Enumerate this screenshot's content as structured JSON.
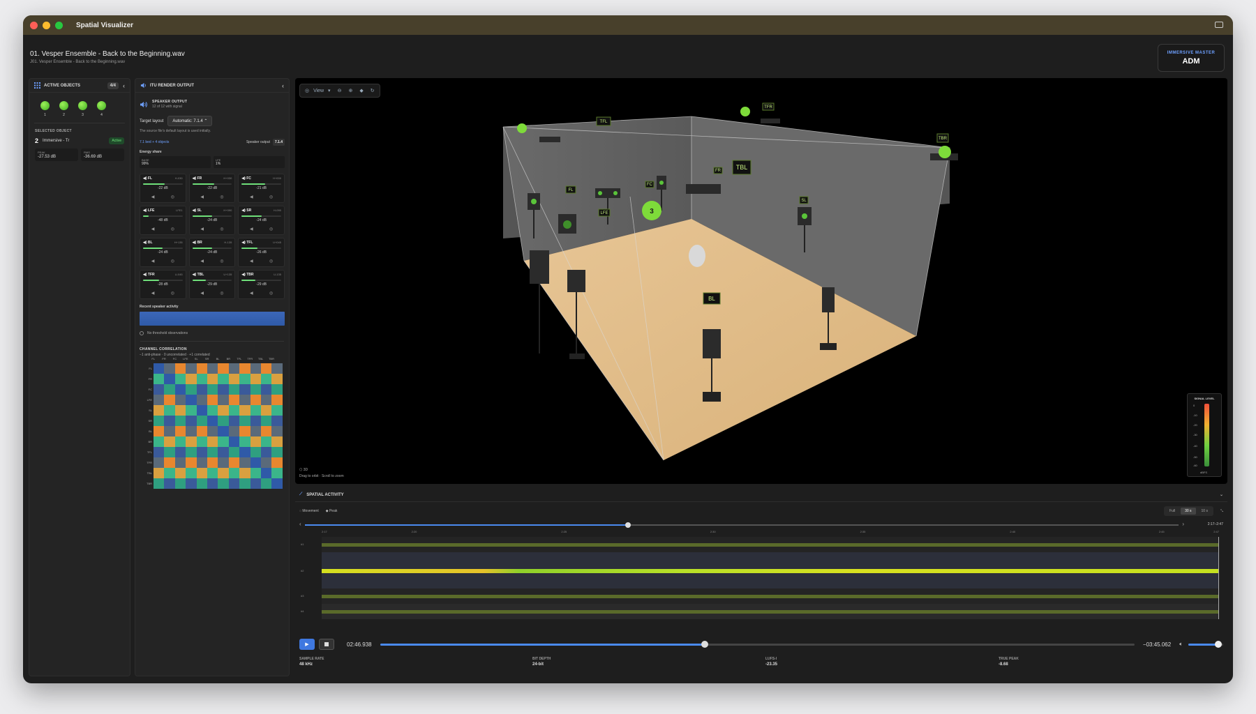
{
  "app": {
    "title": "Spatial Visualizer"
  },
  "file": {
    "title": "01. Vesper Ensemble - Back to the Beginning.wav",
    "subtitle": "J01. Vesper Ensemble - Back to the Beginning.wav"
  },
  "badge": {
    "top": "IMMERSIVE MASTER",
    "main": "ADM"
  },
  "objects_panel": {
    "title": "ACTIVE OBJECTS",
    "count": "4/4",
    "objects": [
      "1",
      "2",
      "3",
      "4"
    ],
    "selected_label": "SELECTED OBJECT",
    "selected_num": "2",
    "selected_name": "Immersive - Tr",
    "active": "Active",
    "peak_label": "PEAK",
    "peak": "-27.53 dB",
    "rms_label": "RMS",
    "rms": "-36.69 dB"
  },
  "render_panel": {
    "title": "ITU RENDER OUTPUT",
    "speaker_output": "SPEAKER OUTPUT",
    "speaker_sub": "12 of 12 with signal",
    "target_label": "Target layout",
    "target_value": "Automatic: 7.1.4",
    "note": "The source file's default layout is used initially.",
    "mix": "7.1 bed + 4 objects",
    "out_label": "Speaker output",
    "out_value": "7.1.4",
    "energy_label": "Energy share",
    "base_label": "BASE",
    "base": "99%",
    "lfe_label": "LFE",
    "lfe": "1%",
    "speakers": [
      {
        "name": "FL",
        "az": "H-030",
        "db": "-22 dB",
        "level": 0.55
      },
      {
        "name": "FR",
        "az": "H+030",
        "db": "-22 dB",
        "level": 0.55
      },
      {
        "name": "FC",
        "az": "H+000",
        "db": "-21 dB",
        "level": 0.6
      },
      {
        "name": "LFE",
        "az": "LFE1",
        "db": "-48 dB",
        "level": 0.15
      },
      {
        "name": "SL",
        "az": "H+090",
        "db": "-24 dB",
        "level": 0.5
      },
      {
        "name": "SR",
        "az": "H-090",
        "db": "-24 dB",
        "level": 0.5
      },
      {
        "name": "BL",
        "az": "H+135",
        "db": "-24 dB",
        "level": 0.5
      },
      {
        "name": "BR",
        "az": "H-135",
        "db": "-24 dB",
        "level": 0.5
      },
      {
        "name": "TFL",
        "az": "U+045",
        "db": "-26 dB",
        "level": 0.4
      },
      {
        "name": "TFR",
        "az": "U-045",
        "db": "-28 dB",
        "level": 0.4
      },
      {
        "name": "TBL",
        "az": "U+135",
        "db": "-29 dB",
        "level": 0.35
      },
      {
        "name": "TBR",
        "az": "U-135",
        "db": "-29 dB",
        "level": 0.35
      }
    ],
    "recent_label": "Recent speaker activity",
    "no_threshold": "No threshold observations",
    "corr_title": "CHANNEL CORRELATION",
    "corr_sub": "−1 anti-phase · 0 uncorrelated · +1 correlated",
    "corr_labels": [
      "FL",
      "FR",
      "FC",
      "LFE",
      "SL",
      "SR",
      "BL",
      "BR",
      "TFL",
      "TFR",
      "TBL",
      "TBR"
    ]
  },
  "viewport": {
    "view": "View",
    "mode": "3D",
    "hint": "Drag to orbit · Scroll to zoom",
    "signal_title": "SIGNAL LEVEL",
    "ticks": [
      "0",
      "-10",
      "-20",
      "-30",
      "-40",
      "-50",
      "-60"
    ],
    "unit": "dBFS",
    "speaker_labels": [
      "TFL",
      "TFR",
      "TBL",
      "TBR",
      "FL",
      "FR",
      "FC",
      "LFE",
      "SL",
      "BL"
    ],
    "object_labels": [
      "1",
      "2",
      "3",
      "4"
    ]
  },
  "activity": {
    "title": "SPATIAL ACTIVITY",
    "movement": "Movement",
    "peak": "Peak",
    "ranges": [
      "Full",
      "30 s",
      "10 s"
    ],
    "range_selected": "30 s",
    "range_text": "2:17–2:47",
    "times": [
      "2:17",
      "2:20",
      "2:25",
      "2:30",
      "2:35",
      "2:40",
      "2:45",
      "2:47"
    ],
    "lanes": [
      "#1",
      "#2",
      "#3",
      "#4"
    ]
  },
  "transport": {
    "current": "02:46.938",
    "remaining": "−03:45.062",
    "progress": 0.43,
    "volume": 0.85
  },
  "stats": [
    {
      "k": "SAMPLE RATE",
      "v": "48 kHz"
    },
    {
      "k": "BIT DEPTH",
      "v": "24-bit"
    },
    {
      "k": "LUFS-I",
      "v": "-23.35"
    },
    {
      "k": "TRUE PEAK",
      "v": "-8.68"
    }
  ],
  "colors": {
    "accent": "#4a8af0",
    "green": "#6fe07a",
    "orange": "#e8872f",
    "teal": "#3bb58a",
    "slate": "#3a5a9a"
  }
}
